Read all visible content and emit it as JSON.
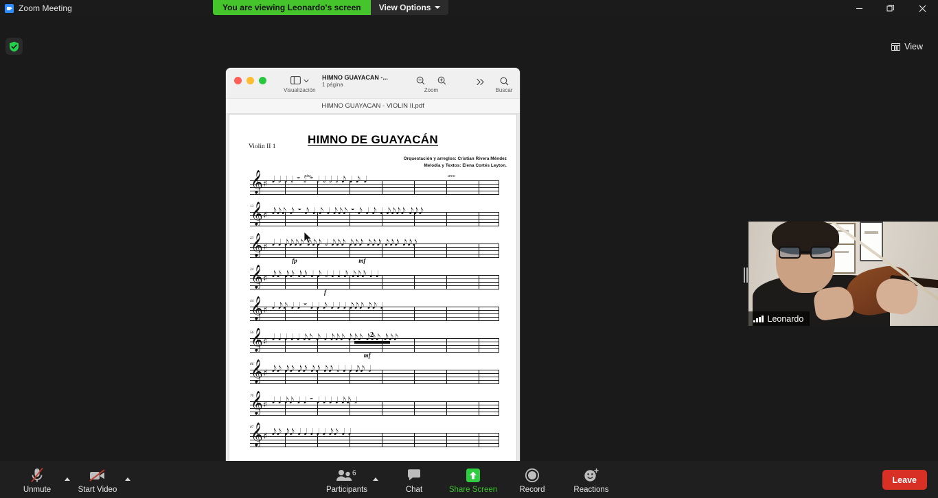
{
  "window": {
    "app_title": "Zoom Meeting",
    "logo_icon": "zoom-logo-icon",
    "minimize_icon": "minimize-icon",
    "maximize_icon": "maximize-icon",
    "close_icon": "close-icon"
  },
  "share_banner": {
    "message": "You are viewing Leonardo's screen",
    "view_options_label": "View Options",
    "caret_icon": "chevron-down-icon",
    "green": "#45c42b"
  },
  "stage": {
    "encryption_icon": "shield-check-icon",
    "view_button_label": "View",
    "view_icon": "grid-view-icon"
  },
  "shared_window": {
    "app": "preview",
    "traffic_lights": [
      "close",
      "minimize",
      "zoom"
    ],
    "toolbar": {
      "sidebar_label": "Visualización",
      "sidebar_icon": "sidebar-icon",
      "sidebar_caret_icon": "chevron-down-icon",
      "doc_name": "HIMNO GUAYACAN -...",
      "doc_pages": "1 página",
      "zoom_label": "Zoom",
      "zoom_out_icon": "zoom-out-icon",
      "zoom_in_icon": "zoom-in-icon",
      "overflow_icon": "chevron-double-right-icon",
      "search_label": "Buscar",
      "search_icon": "search-icon"
    },
    "filename": "HIMNO GUAYACAN - VIOLIN II.pdf"
  },
  "sheet_music": {
    "title": "HIMNO DE GUAYACÁN",
    "part_label": "Violin II 1",
    "credit_line_1": "Orquestación y arreglos: Cristian Rivera Méndez",
    "credit_line_2": "Melodía y Textos: Elena Cortés Leyton.",
    "clef": "𝄞",
    "key_signature": "♯",
    "systems": [
      {
        "measure_number": "",
        "articulations": [
          {
            "text": "pizz.",
            "left_pct": 22
          },
          {
            "text": "arco",
            "left_pct": 80
          }
        ],
        "dynamics": [],
        "multirest": "",
        "notes": "𝅘𝅥 𝅗𝅥   𝅗𝅥   𝅗𝅥  𝄻   𝅗𝅥   𝄻   𝅗𝅥 𝅗𝅥 𝅗𝅥 𝅗𝅥  𝅘𝅥𝅮 𝅘𝅥  𝅘𝅥𝅮 𝅘𝅥"
      },
      {
        "measure_number": "13",
        "articulations": [],
        "dynamics": [],
        "multirest": "",
        "notes": "𝅘𝅥𝅮𝅘𝅥𝅮𝅘𝅥𝅮 𝅘𝅥𝅮  𝄻  𝅘𝅥𝅮 𝅘𝅥  𝅘𝅥𝅮 𝅘𝅥  𝅘𝅥𝅮𝅘𝅥𝅮𝅘𝅥𝅮  𝄻  𝅘𝅥𝅮 𝅘𝅥  𝅘𝅥𝅮 𝅘𝅥  𝅘𝅥𝅮𝅘𝅥𝅮𝅘𝅥𝅮𝅘𝅥𝅮 𝅘𝅥𝅮𝅘𝅥𝅮𝅘𝅥𝅮"
      },
      {
        "measure_number": "23",
        "articulations": [],
        "dynamics": [
          {
            "text": "fp",
            "left_pct": 17
          },
          {
            "text": "mf",
            "left_pct": 44
          }
        ],
        "multirest": "",
        "notes": "𝅘𝅥 𝅘𝅥 𝅘𝅥𝅮𝅘𝅥𝅮𝅘𝅥𝅮𝅘𝅥𝅮 𝅘𝅥𝅮𝅘𝅥𝅮𝅘𝅥𝅮 𝅗𝅥 𝅘𝅥𝅮𝅘𝅥𝅮𝅘𝅥𝅮 𝅘𝅥𝅮𝅘𝅥𝅮𝅘𝅥𝅮 𝅘𝅥𝅮𝅘𝅥𝅮𝅘𝅥𝅮 𝅘𝅥𝅮𝅘𝅥𝅮𝅘𝅥𝅮 𝅘𝅥𝅮𝅘𝅥𝅮𝅘𝅥𝅮"
      },
      {
        "measure_number": "34",
        "articulations": [],
        "dynamics": [
          {
            "text": "f",
            "left_pct": 30
          }
        ],
        "multirest": "",
        "notes": "𝅘𝅥𝅮𝅘𝅥𝅮 𝅘𝅥𝅮𝅘𝅥𝅮 𝅘𝅥𝅮𝅘𝅥𝅮 𝅘𝅥 𝅘𝅥𝅮 𝅗𝅥 𝅘𝅥 𝅘𝅥 𝅘𝅥𝅮 𝅘𝅥𝅮𝅘𝅥𝅮𝅘𝅥𝅮 𝅘𝅥 𝅘𝅥"
      },
      {
        "measure_number": "44",
        "articulations": [],
        "dynamics": [],
        "multirest": "",
        "notes": "𝅘𝅥 𝅘𝅥𝅮𝅘𝅥𝅮 𝅘𝅥 𝅘𝅥 𝄻  𝅘𝅥 𝅘𝅥 𝅘𝅥𝅮 𝅘𝅥 𝅘𝅥 𝅘𝅥 𝅘𝅥𝅮𝅘𝅥𝅮𝅘𝅥𝅮 𝅘𝅥𝅮𝅘𝅥𝅮 𝅘𝅥"
      },
      {
        "measure_number": "56",
        "articulations": [],
        "dynamics": [
          {
            "text": "mf",
            "left_pct": 46
          }
        ],
        "multirest": "2",
        "notes": "𝅘𝅥 𝅘𝅥 𝅘𝅥 𝅘𝅥 𝅘𝅥 𝅘𝅥𝅮𝅘𝅥𝅮 𝅘𝅥𝅮 𝅘𝅥         𝅘𝅥𝅮𝅘𝅥𝅮𝅘𝅥𝅮 𝅘𝅥𝅮𝅘𝅥𝅮𝅘𝅥𝅮 𝅘𝅥𝅮𝅘𝅥𝅮𝅘𝅥𝅮 𝅘𝅥𝅮𝅘𝅥𝅮𝅘𝅥𝅮"
      },
      {
        "measure_number": "66",
        "articulations": [],
        "dynamics": [],
        "multirest": "",
        "notes": "𝅘𝅥𝅮𝅘𝅥𝅮 𝅘𝅥𝅮𝅘𝅥𝅮 𝅘𝅥𝅮𝅘𝅥𝅮 𝅘𝅥𝅮𝅘𝅥𝅮 𝅘𝅥𝅮𝅘𝅥𝅮 𝅗𝅥 𝅘𝅥 𝅘𝅥 𝅘𝅥𝅮𝅘𝅥𝅮 𝅗𝅥"
      },
      {
        "measure_number": "76",
        "articulations": [],
        "dynamics": [],
        "multirest": "",
        "notes": "𝅘𝅥 𝅘𝅥 𝅘𝅥𝅮𝅘𝅥𝅮 𝅘𝅥 𝅘𝅥 𝄻  𝅘𝅥 𝅘𝅥 𝅘𝅥 𝅘𝅥 𝅘𝅥𝅮𝅘𝅥𝅮 𝅗𝅥"
      },
      {
        "measure_number": "87",
        "articulations": [],
        "dynamics": [],
        "multirest": "",
        "notes": "𝅘𝅥𝅮𝅘𝅥𝅮 𝅘𝅥𝅮𝅘𝅥𝅮 𝅘𝅥 𝅘𝅥 𝅘𝅥 𝅘𝅥 𝅘𝅥 𝅘𝅥𝅮𝅘𝅥𝅮 𝅘𝅥 𝅗𝅥"
      }
    ]
  },
  "video_tile": {
    "participant_name": "Leonardo",
    "signal_icon": "signal-bars-icon"
  },
  "toolbar": {
    "items": [
      {
        "label": "Unmute",
        "icon": "microphone-muted-icon",
        "name": "unmute-button",
        "caret": true,
        "green": false
      },
      {
        "label": "Start Video",
        "icon": "camera-off-icon",
        "name": "start-video-button",
        "caret": true,
        "green": false
      },
      {
        "label": "Participants",
        "icon": "participants-icon",
        "name": "participants-button",
        "caret": true,
        "green": false,
        "badge": "6"
      },
      {
        "label": "Chat",
        "icon": "chat-bubble-icon",
        "name": "chat-button",
        "caret": false,
        "green": false
      },
      {
        "label": "Share Screen",
        "icon": "share-screen-icon",
        "name": "share-screen-button",
        "caret": false,
        "green": true
      },
      {
        "label": "Record",
        "icon": "record-circle-icon",
        "name": "record-button",
        "caret": false,
        "green": false
      },
      {
        "label": "Reactions",
        "icon": "reactions-smiley-icon",
        "name": "reactions-button",
        "caret": false,
        "green": false
      }
    ],
    "participants_count": "6",
    "leave_label": "Leave",
    "accent_green": "#3ec02e",
    "leave_red": "#d93025"
  }
}
